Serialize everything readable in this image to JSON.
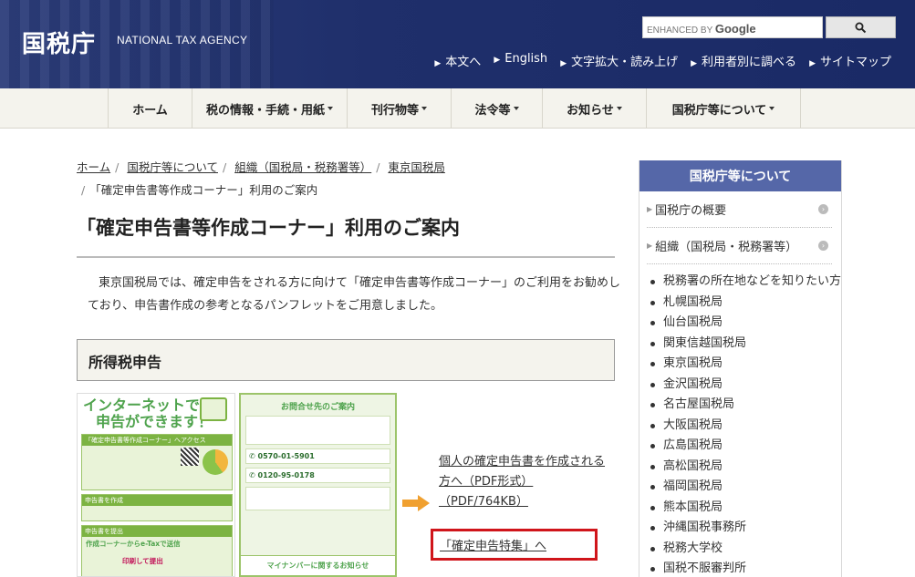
{
  "header": {
    "logo": "国税庁",
    "logo_en": "NATIONAL TAX AGENCY",
    "search_prefix": "ENHANCED BY",
    "search_brand": "Google",
    "search_button_icon": "search-icon",
    "utility": [
      "本文へ",
      "English",
      "文字拡大・読み上げ",
      "利用者別に調べる",
      "サイトマップ"
    ]
  },
  "nav": [
    {
      "label": "ホーム",
      "caret": false
    },
    {
      "label": "税の情報・手続・用紙",
      "caret": true
    },
    {
      "label": "刊行物等",
      "caret": true
    },
    {
      "label": "法令等",
      "caret": true
    },
    {
      "label": "お知らせ",
      "caret": true
    },
    {
      "label": "国税庁等について",
      "caret": true
    }
  ],
  "breadcrumb": {
    "items": [
      "ホーム",
      "国税庁等について",
      "組織（国税局・税務署等）",
      "東京国税局"
    ],
    "current": "「確定申告書等作成コーナー」利用のご案内"
  },
  "main": {
    "title": "「確定申告書等作成コーナー」利用のご案内",
    "intro": "東京国税局では、確定申告をされる方に向けて「確定申告書等作成コーナー」のご利用をお勧めしており、申告書作成の参考となるパンフレットをご用意しました。",
    "section": "所得税申告",
    "pdf_link": "個人の確定申告書を作成される方へ（PDF形式）",
    "pdf_size": "（PDF/764KB）",
    "tokushu_link": "「確定申告特集」へ"
  },
  "pamphlet": {
    "p1_title_line1": "インターネットで",
    "p1_title_line2": "申告ができます！",
    "p1_box1_head": "「確定申告書等作成コーナー」へアクセス",
    "p1_box2_head": "申告書を作成",
    "p1_box3_head": "申告書を提出",
    "p1_box3_sub": "作成コーナーからe-Taxで送信",
    "p1_box3_print": "印刷して提出",
    "p2_head": "お問合せ先のご案内",
    "p2_phone1": "0570-01-5901",
    "p2_phone2": "0120-95-0178",
    "p2_foot": "マイナンバーに関するお知らせ"
  },
  "sidebar": {
    "heading": "国税庁等について",
    "rows": [
      "国税庁の概要",
      "組織（国税局・税務署等）"
    ],
    "items": [
      "税務署の所在地などを知りたい方",
      "札幌国税局",
      "仙台国税局",
      "関東信越国税局",
      "東京国税局",
      "金沢国税局",
      "名古屋国税局",
      "大阪国税局",
      "広島国税局",
      "高松国税局",
      "福岡国税局",
      "熊本国税局",
      "沖縄国税事務所",
      "税務大学校",
      "国税不服審判所"
    ]
  }
}
